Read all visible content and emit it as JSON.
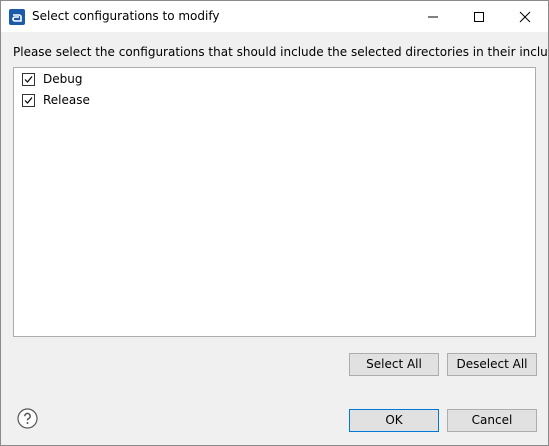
{
  "window": {
    "title": "Select configurations to modify",
    "icon": "app-logo-icon"
  },
  "titlebar_buttons": [
    "minimize-icon",
    "maximize-icon",
    "close-icon"
  ],
  "instruction": "Please select the configurations that should include the selected directories in their include paths.",
  "configurations": [
    {
      "label": "Debug",
      "checked": true
    },
    {
      "label": "Release",
      "checked": true
    }
  ],
  "buttons": {
    "select_all": "Select All",
    "deselect_all": "Deselect All",
    "ok": "OK",
    "cancel": "Cancel"
  },
  "help_icon": "help-icon",
  "colors": {
    "title_bar": "#ffffff",
    "dialog_bg": "#f0f0f0",
    "app_icon": "#1a5aa8",
    "default_button_border": "#0078d7"
  }
}
